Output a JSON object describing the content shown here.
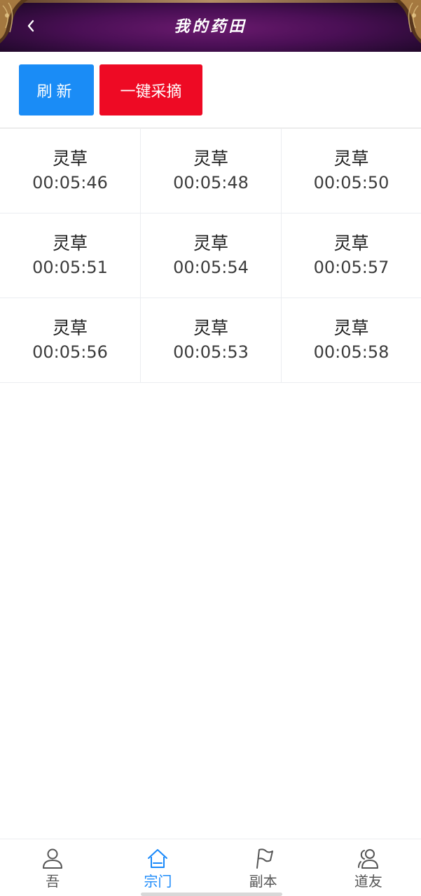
{
  "header": {
    "title": "我的药田",
    "back_icon": "chevron-left-icon"
  },
  "actions": {
    "refresh_label": "刷新",
    "harvest_all_label": "一键采摘"
  },
  "colors": {
    "refresh": "#1a8cf6",
    "harvest": "#ee0a24",
    "active_tab": "#1989fa",
    "header_bg": "#4a0f55"
  },
  "plots": [
    {
      "name": "灵草",
      "time": "00:05:46"
    },
    {
      "name": "灵草",
      "time": "00:05:48"
    },
    {
      "name": "灵草",
      "time": "00:05:50"
    },
    {
      "name": "灵草",
      "time": "00:05:51"
    },
    {
      "name": "灵草",
      "time": "00:05:54"
    },
    {
      "name": "灵草",
      "time": "00:05:57"
    },
    {
      "name": "灵草",
      "time": "00:05:56"
    },
    {
      "name": "灵草",
      "time": "00:05:53"
    },
    {
      "name": "灵草",
      "time": "00:05:58"
    }
  ],
  "tabbar": {
    "items": [
      {
        "label": "吾",
        "icon": "person-icon",
        "active": false
      },
      {
        "label": "宗门",
        "icon": "home-icon",
        "active": true
      },
      {
        "label": "副本",
        "icon": "flag-icon",
        "active": false
      },
      {
        "label": "道友",
        "icon": "friends-icon",
        "active": false
      }
    ]
  }
}
